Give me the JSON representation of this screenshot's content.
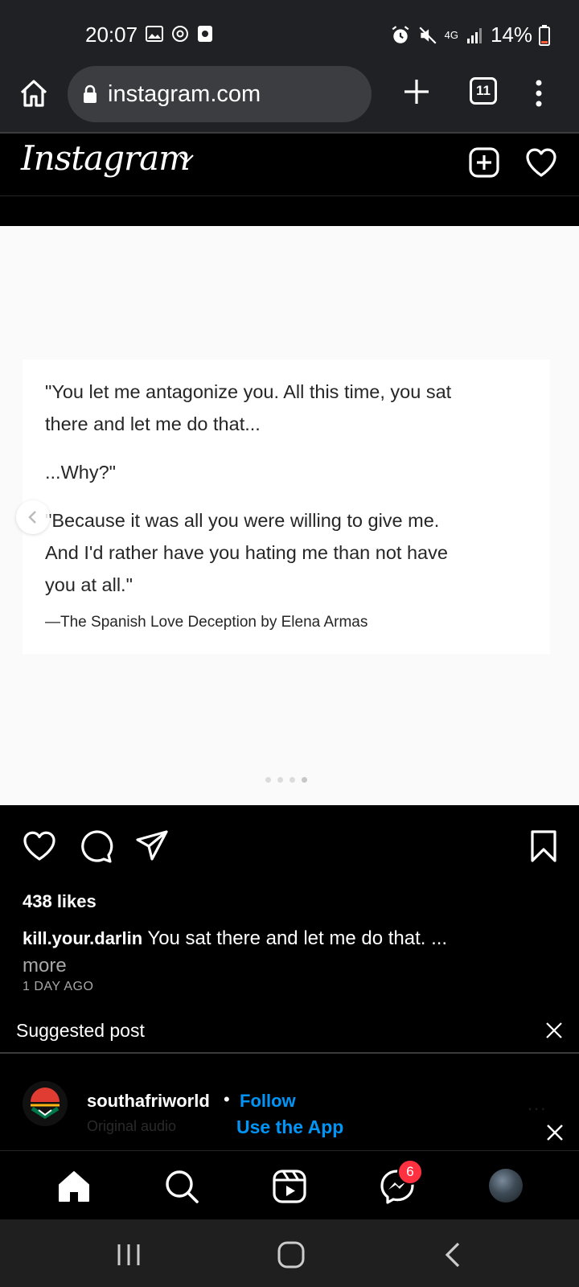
{
  "status_bar": {
    "time": "20:07",
    "network": "4G",
    "battery": "14%"
  },
  "browser": {
    "url": "instagram.com",
    "tab_count": "11"
  },
  "ig_header": {
    "logo": "Instagram"
  },
  "post": {
    "quote_lines": [
      "\"You let me antagonize you. All this time, you sat",
      "there and let me do that...",
      "...Why?\"",
      "\"Because it was all you were willing to give me.",
      "And I'd rather have you hating me than not have",
      "you at all.\""
    ],
    "attribution": "—The Spanish Love Deception by Elena Armas",
    "carousel_pages": 4,
    "carousel_active_index": 3,
    "likes": "438 likes",
    "username": "kill.your.darlin",
    "caption": "You sat there and let me do that. ...",
    "more": "more",
    "time_ago": "1 DAY AGO"
  },
  "suggested": {
    "label": "Suggested post",
    "username": "southafriworld",
    "separator": "•",
    "follow": "Follow",
    "audio": "Original audio",
    "more_dots": "..."
  },
  "use_app": {
    "label": "Use the App"
  },
  "bottom_nav": {
    "messages_badge": "6"
  },
  "colors": {
    "ig_blue": "#0095f6",
    "badge_red": "#ff3040",
    "browser_bar": "#202124"
  }
}
